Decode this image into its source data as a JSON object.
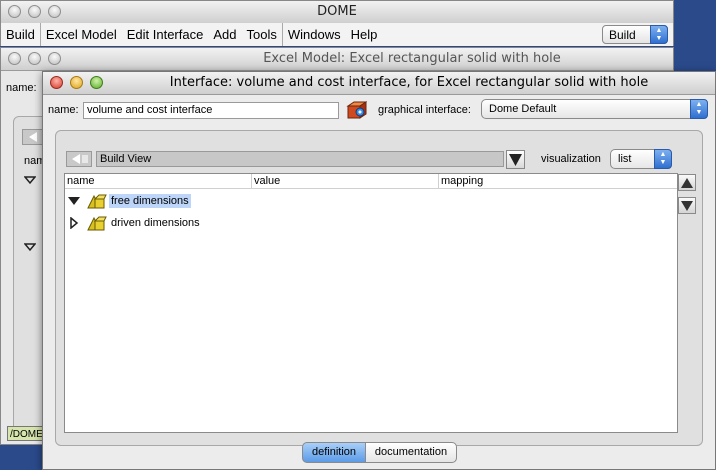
{
  "dome_window": {
    "title": "DOME",
    "menus": [
      "Build",
      "Excel Model",
      "Edit Interface",
      "Add",
      "Tools",
      "Windows",
      "Help"
    ],
    "mode_select": "Build"
  },
  "excel_window": {
    "title": "Excel Model: Excel rectangular solid with hole",
    "name_label": "name:",
    "col_label": "nam",
    "status_text": "/DOME"
  },
  "interface_window": {
    "title": "Interface: volume and cost interface, for Excel rectangular solid with hole",
    "name_label": "name:",
    "name_value": "volume and cost interface",
    "graphical_interface_label": "graphical interface:",
    "graphical_interface_value": "Dome Default",
    "view_value": "Build View",
    "visualization_label": "visualization",
    "visualization_value": "list",
    "columns": [
      "name",
      "value",
      "mapping"
    ],
    "tree_items": [
      {
        "label": "free dimensions",
        "expanded": true,
        "selected": true
      },
      {
        "label": "driven dimensions",
        "expanded": false,
        "selected": false
      }
    ],
    "tabs": [
      {
        "label": "definition",
        "active": true
      },
      {
        "label": "documentation",
        "active": false
      }
    ]
  }
}
